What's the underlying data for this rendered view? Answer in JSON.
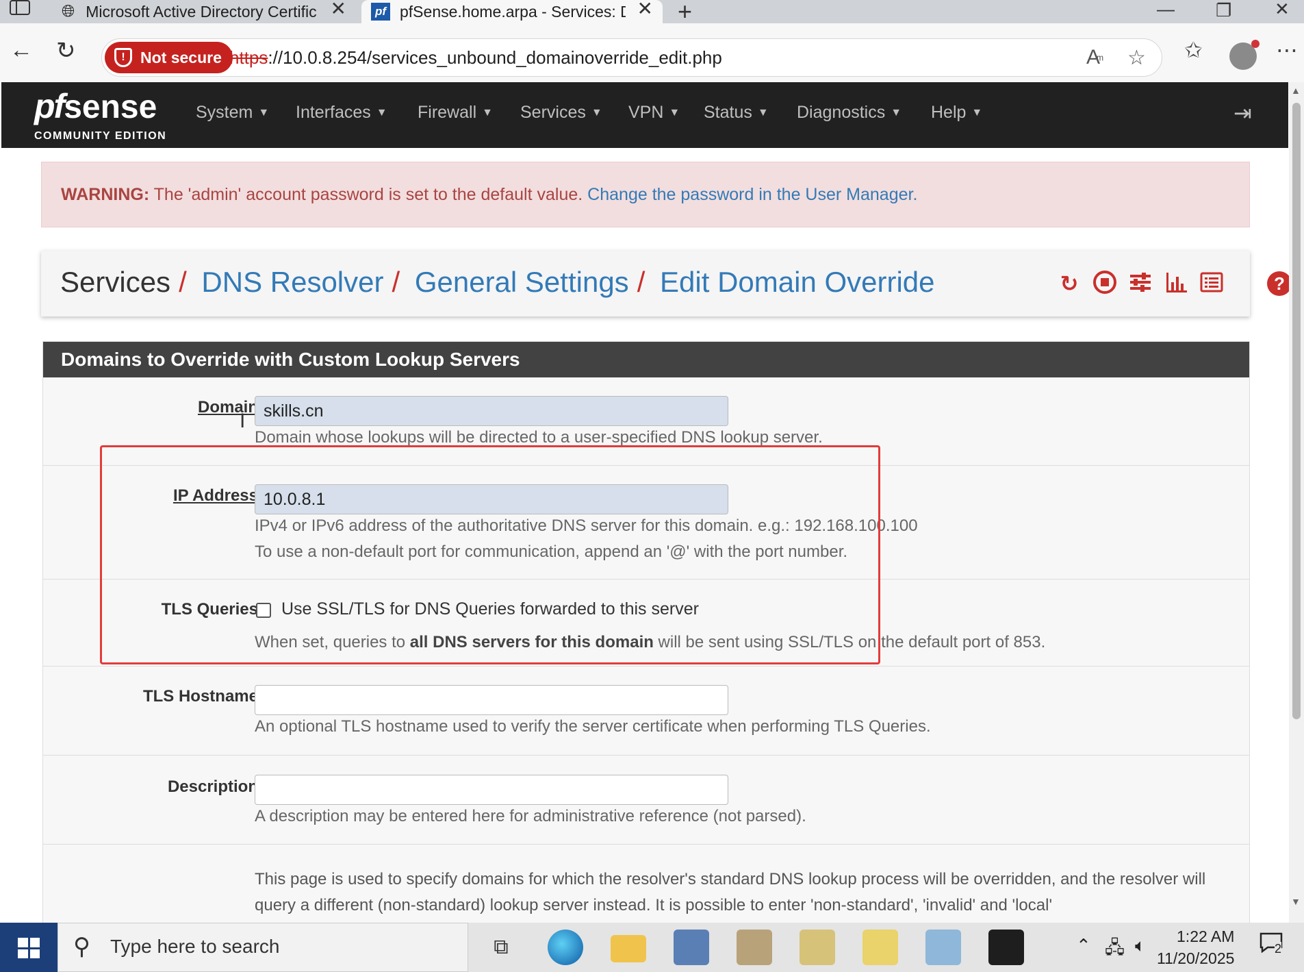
{
  "browser": {
    "tabs": [
      {
        "title": "Microsoft Active Directory Certific",
        "icon": "globe-icon"
      },
      {
        "title": "pfSense.home.arpa - Services: DN",
        "icon": "pfsense-favicon"
      }
    ],
    "not_secure_label": "Not secure",
    "url_protocol": "https",
    "url_rest": "://10.0.8.254/services_unbound_domainoverride_edit.php"
  },
  "pfsense": {
    "logo_pf": "pf",
    "logo_sense": "sense",
    "logo_edition": "COMMUNITY EDITION",
    "menu": [
      "System",
      "Interfaces",
      "Firewall",
      "Services",
      "VPN",
      "Status",
      "Diagnostics",
      "Help"
    ]
  },
  "alert": {
    "prefix": "WARNING:",
    "text": " The 'admin' account password is set to the default value. ",
    "link": "Change the password in the User Manager."
  },
  "breadcrumb": [
    "Services",
    "DNS Resolver",
    "General Settings",
    "Edit Domain Override"
  ],
  "panel": {
    "title": "Domains to Override with Custom Lookup Servers",
    "domain": {
      "label": "Domain",
      "value": "skills.cn",
      "help": "Domain whose lookups will be directed to a user-specified DNS lookup server."
    },
    "ip": {
      "label": "IP Address",
      "value": "10.0.8.1",
      "help1": "IPv4 or IPv6 address of the authoritative DNS server for this domain. e.g.: 192.168.100.100",
      "help2": "To use a non-default port for communication, append an '@' with the port number."
    },
    "tls_queries": {
      "label": "TLS Queries",
      "checkbox_label": "Use SSL/TLS for DNS Queries forwarded to this server",
      "checked": false,
      "help_pre": "When set, queries to ",
      "help_bold": "all DNS servers for this domain",
      "help_post": " will be sent using SSL/TLS on the default port of 853."
    },
    "tls_hostname": {
      "label": "TLS Hostname",
      "value": "",
      "help": "An optional TLS hostname used to verify the server certificate when performing TLS Queries."
    },
    "description": {
      "label": "Description",
      "value": "",
      "help": "A description may be entered here for administrative reference (not parsed)."
    },
    "info": "This page is used to specify domains for which the resolver's standard DNS lookup process will be overridden, and the resolver will query a different (non-standard) lookup server instead. It is possible to enter 'non-standard', 'invalid' and 'local'"
  },
  "taskbar": {
    "search_placeholder": "Type here to search",
    "time": "1:22 AM",
    "date": "11/20/2025",
    "notification_count": "2"
  },
  "colors": {
    "pf_nav": "#212121",
    "alert_bg": "#f2dede",
    "alert_text": "#a94442",
    "link": "#337ab7",
    "accent_red": "#c9302c",
    "annotation_box": "#e33b3b"
  }
}
